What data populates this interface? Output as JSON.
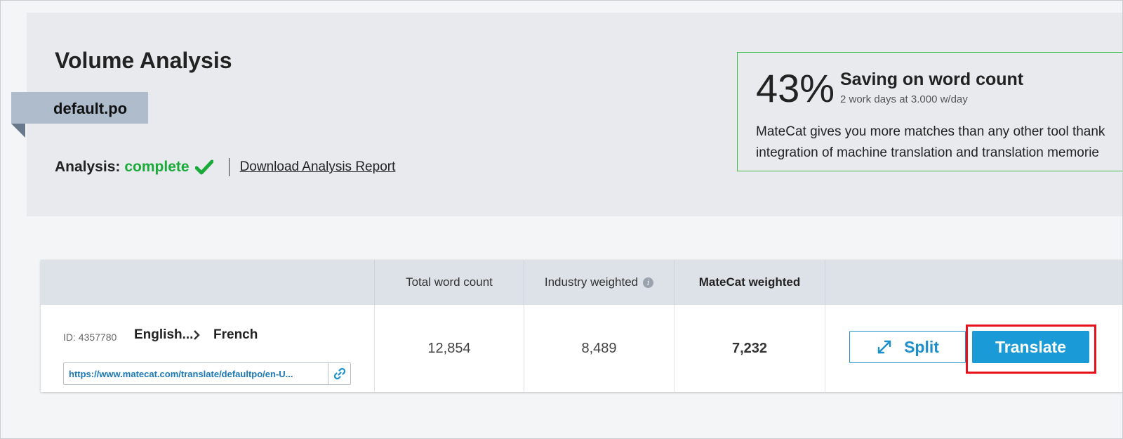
{
  "header": {
    "title": "Volume Analysis",
    "file_name": "default.po",
    "analysis_label": "Analysis:",
    "analysis_status": "complete",
    "download_link": "Download Analysis Report"
  },
  "saving": {
    "percent": "43%",
    "title": "Saving on word count",
    "subtitle": "2 work days at 3.000 w/day",
    "description_line1": "MateCat gives you more matches than any other tool thank",
    "description_line2": "integration of machine translation and translation memorie"
  },
  "table": {
    "headers": {
      "job": "",
      "total": "Total word count",
      "industry": "Industry weighted",
      "matecat": "MateCat weighted",
      "actions": ""
    },
    "row": {
      "id_label": "ID: 4357780",
      "source_lang": "English...",
      "target_lang": "French",
      "url": "https://www.matecat.com/translate/defaultpo/en-U...",
      "total": "12,854",
      "industry": "8,489",
      "matecat": "7,232",
      "split_label": "Split",
      "translate_label": "Translate"
    }
  },
  "icons": {
    "check": "check-icon",
    "info": "info-icon",
    "chevron": "chevron-right-icon",
    "link": "link-icon",
    "split": "expand-arrows-icon"
  },
  "colors": {
    "status_green": "#1aaa3a",
    "accent_blue": "#1a9bd7",
    "highlight_red": "#e8101a",
    "saving_border": "#3fbf4a"
  }
}
